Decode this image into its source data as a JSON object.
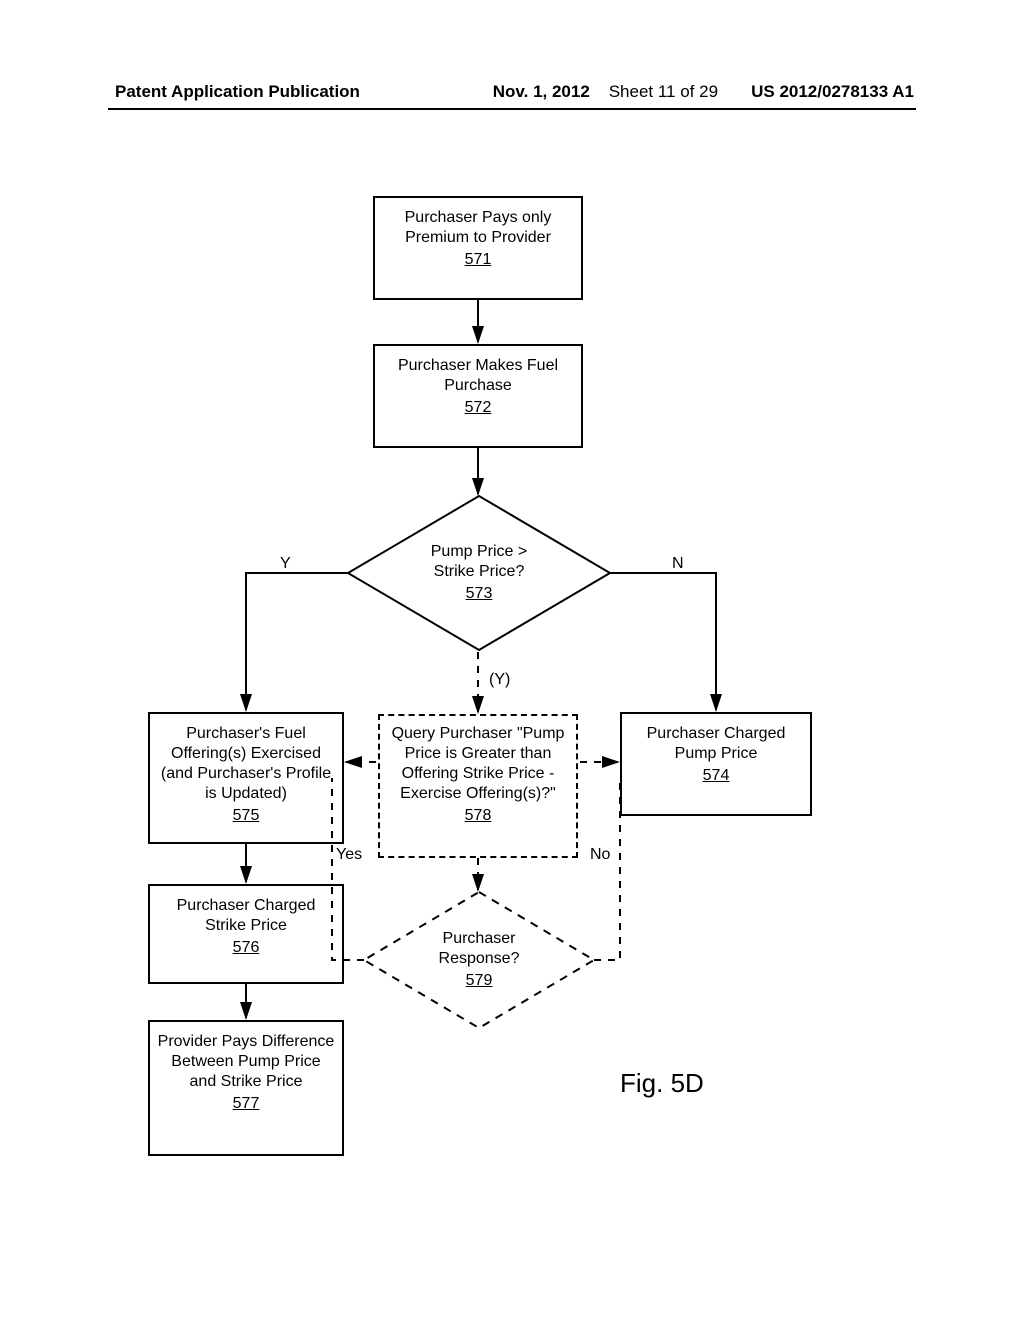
{
  "header": {
    "left": "Patent Application Publication",
    "date": "Nov. 1, 2012",
    "sheet": "Sheet 11 of 29",
    "pubno": "US 2012/0278133 A1"
  },
  "figure_label": "Fig. 5D",
  "boxes": {
    "b571": {
      "text": "Purchaser Pays only Premium to Provider",
      "ref": "571"
    },
    "b572": {
      "text": "Purchaser Makes Fuel Purchase",
      "ref": "572"
    },
    "b574": {
      "text": "Purchaser Charged Pump Price",
      "ref": "574"
    },
    "b575": {
      "text": "Purchaser's Fuel Offering(s) Exercised (and Purchaser's Profile is Updated)",
      "ref": "575"
    },
    "b576": {
      "text": "Purchaser Charged Strike Price",
      "ref": "576"
    },
    "b577": {
      "text": "Provider Pays Difference Between Pump Price and Strike Price",
      "ref": "577"
    },
    "b578": {
      "text": "Query Purchaser \"Pump Price is Greater than Offering Strike Price - Exercise Offering(s)?\"",
      "ref": "578"
    }
  },
  "diamonds": {
    "d573": {
      "line1": "Pump Price >",
      "line2": "Strike Price?",
      "ref": "573"
    },
    "d579": {
      "line1": "Purchaser",
      "line2": "Response?",
      "ref": "579"
    }
  },
  "edge_labels": {
    "y_left": "Y",
    "n_right": "N",
    "y_paren": "(Y)",
    "yes": "Yes",
    "no": "No"
  }
}
